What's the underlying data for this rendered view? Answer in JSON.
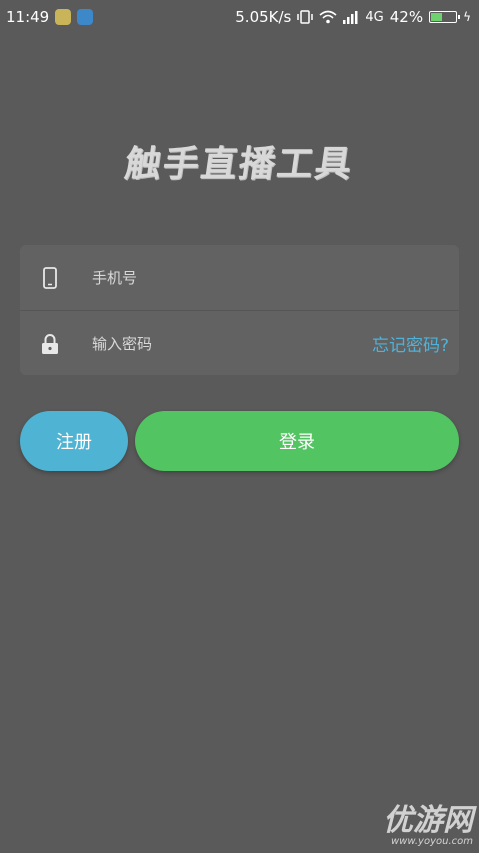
{
  "status_bar": {
    "time": "11:49",
    "net_speed": "5.05K/s",
    "network": "4G",
    "battery": "42%",
    "battery_level": 0.42
  },
  "app": {
    "title": "触手直播工具"
  },
  "login_form": {
    "phone_placeholder": "手机号",
    "password_placeholder": "输入密码",
    "forgot_label": "忘记密码?"
  },
  "buttons": {
    "register_label": "注册",
    "login_label": "登录"
  },
  "watermark": {
    "main": "优游网",
    "sub": "www.yoyou.com"
  },
  "colors": {
    "background": "#5a5a5a",
    "register": "#4fb3d3",
    "login": "#52c462",
    "forgot": "#4fb3d9"
  }
}
